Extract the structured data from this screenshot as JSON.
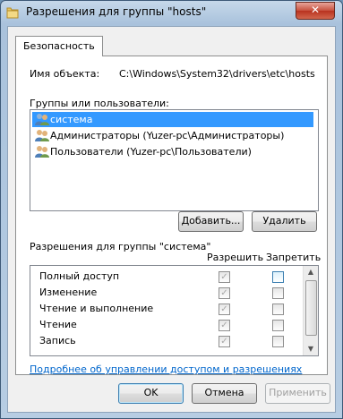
{
  "window": {
    "title": "Разрешения для группы \"hosts\"",
    "close_symbol": "✕"
  },
  "tab": {
    "label": "Безопасность"
  },
  "object": {
    "label": "Имя объекта:",
    "value": "C:\\Windows\\System32\\drivers\\etc\\hosts"
  },
  "groups": {
    "label": "Группы или пользователи:",
    "items": [
      {
        "label": "система",
        "selected": true
      },
      {
        "label": "Администраторы (Yuzer-pc\\Администраторы)",
        "selected": false
      },
      {
        "label": "Пользователи (Yuzer-pc\\Пользователи)",
        "selected": false
      }
    ]
  },
  "buttons": {
    "add": "Добавить...",
    "remove": "Удалить",
    "ok": "OK",
    "cancel": "Отмена",
    "apply": "Применить"
  },
  "permissions": {
    "label": "Разрешения для группы \"система\"",
    "allow_header": "Разрешить",
    "deny_header": "Запретить",
    "rows": [
      {
        "name": "Полный доступ",
        "allow": true,
        "deny": false
      },
      {
        "name": "Изменение",
        "allow": true,
        "deny": false
      },
      {
        "name": "Чтение и выполнение",
        "allow": true,
        "deny": false
      },
      {
        "name": "Чтение",
        "allow": true,
        "deny": false
      },
      {
        "name": "Запись",
        "allow": true,
        "deny": false
      }
    ]
  },
  "link": {
    "text": "Подробнее об управлении доступом и разрешениях"
  },
  "colors": {
    "selection": "#3399ff",
    "link": "#0066cc",
    "close_button": "#c7503d"
  }
}
